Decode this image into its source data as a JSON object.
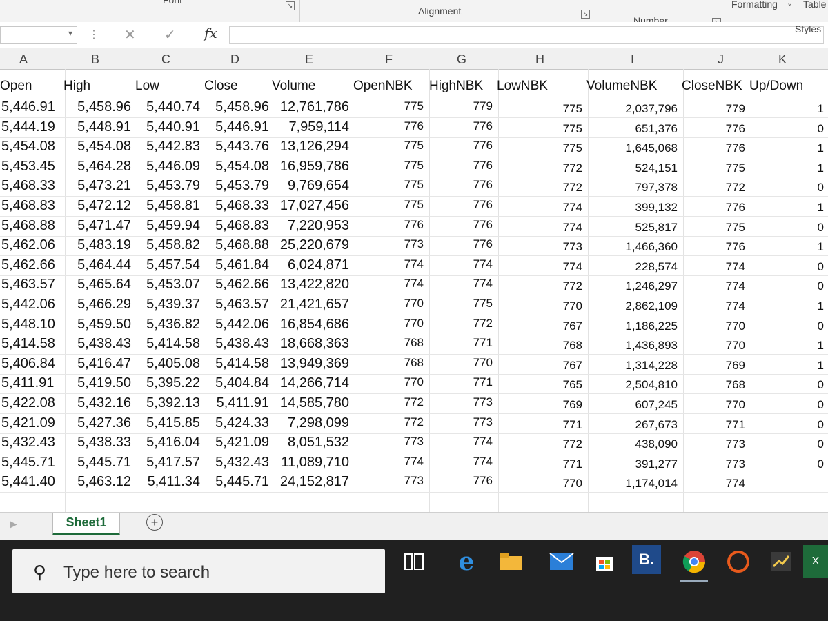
{
  "ribbon": {
    "font_label": "Font",
    "alignment_label": "Alignment",
    "number_label": "Number",
    "formatting_label": "Formatting",
    "table_label": "Table",
    "styles_label": "Styles"
  },
  "formula_bar": {
    "fx_label": "fx",
    "value": ""
  },
  "grid": {
    "column_letters": [
      "A",
      "B",
      "C",
      "D",
      "E",
      "F",
      "G",
      "H",
      "I",
      "J",
      "K"
    ],
    "headers": [
      "Open",
      "High",
      "Low",
      "Close",
      "Volume",
      "OpenNBK",
      "HighNBK",
      "LowNBK",
      "VolumeNBK",
      "CloseNBK",
      "Up/Down"
    ],
    "rows": [
      [
        "5,446.91",
        "5,458.96",
        "5,440.74",
        "5,458.96",
        "12,761,786",
        "775",
        "779",
        "775",
        "2,037,796",
        "779",
        "1"
      ],
      [
        "5,444.19",
        "5,448.91",
        "5,440.91",
        "5,446.91",
        "7,959,114",
        "776",
        "776",
        "775",
        "651,376",
        "776",
        "0"
      ],
      [
        "5,454.08",
        "5,454.08",
        "5,442.83",
        "5,443.76",
        "13,126,294",
        "775",
        "776",
        "775",
        "1,645,068",
        "776",
        "1"
      ],
      [
        "5,453.45",
        "5,464.28",
        "5,446.09",
        "5,454.08",
        "16,959,786",
        "775",
        "776",
        "772",
        "524,151",
        "775",
        "1"
      ],
      [
        "5,468.33",
        "5,473.21",
        "5,453.79",
        "5,453.79",
        "9,769,654",
        "775",
        "776",
        "772",
        "797,378",
        "772",
        "0"
      ],
      [
        "5,468.83",
        "5,472.12",
        "5,458.81",
        "5,468.33",
        "17,027,456",
        "775",
        "776",
        "774",
        "399,132",
        "776",
        "1"
      ],
      [
        "5,468.88",
        "5,471.47",
        "5,459.94",
        "5,468.83",
        "7,220,953",
        "776",
        "776",
        "774",
        "525,817",
        "775",
        "0"
      ],
      [
        "5,462.06",
        "5,483.19",
        "5,458.82",
        "5,468.88",
        "25,220,679",
        "773",
        "776",
        "773",
        "1,466,360",
        "776",
        "1"
      ],
      [
        "5,462.66",
        "5,464.44",
        "5,457.54",
        "5,461.84",
        "6,024,871",
        "774",
        "774",
        "774",
        "228,574",
        "774",
        "0"
      ],
      [
        "5,463.57",
        "5,465.64",
        "5,453.07",
        "5,462.66",
        "13,422,820",
        "774",
        "774",
        "772",
        "1,246,297",
        "774",
        "0"
      ],
      [
        "5,442.06",
        "5,466.29",
        "5,439.37",
        "5,463.57",
        "21,421,657",
        "770",
        "775",
        "770",
        "2,862,109",
        "774",
        "1"
      ],
      [
        "5,448.10",
        "5,459.50",
        "5,436.82",
        "5,442.06",
        "16,854,686",
        "770",
        "772",
        "767",
        "1,186,225",
        "770",
        "0"
      ],
      [
        "5,414.58",
        "5,438.43",
        "5,414.58",
        "5,438.43",
        "18,668,363",
        "768",
        "771",
        "768",
        "1,436,893",
        "770",
        "1"
      ],
      [
        "5,406.84",
        "5,416.47",
        "5,405.08",
        "5,414.58",
        "13,949,369",
        "768",
        "770",
        "767",
        "1,314,228",
        "769",
        "1"
      ],
      [
        "5,411.91",
        "5,419.50",
        "5,395.22",
        "5,404.84",
        "14,266,714",
        "770",
        "771",
        "765",
        "2,504,810",
        "768",
        "0"
      ],
      [
        "5,422.08",
        "5,432.16",
        "5,392.13",
        "5,411.91",
        "14,585,780",
        "772",
        "773",
        "769",
        "607,245",
        "770",
        "0"
      ],
      [
        "5,421.09",
        "5,427.36",
        "5,415.85",
        "5,424.33",
        "7,298,099",
        "772",
        "773",
        "771",
        "267,673",
        "771",
        "0"
      ],
      [
        "5,432.43",
        "5,438.33",
        "5,416.04",
        "5,421.09",
        "8,051,532",
        "773",
        "774",
        "772",
        "438,090",
        "773",
        "0"
      ],
      [
        "5,445.71",
        "5,445.71",
        "5,417.57",
        "5,432.43",
        "11,089,710",
        "774",
        "774",
        "771",
        "391,277",
        "773",
        "0"
      ],
      [
        "5,441.40",
        "5,463.12",
        "5,411.34",
        "5,445.71",
        "24,152,817",
        "773",
        "776",
        "770",
        "1,174,014",
        "774",
        ""
      ]
    ]
  },
  "sheet_tabs": {
    "active": "Sheet1",
    "add_label": "+"
  },
  "taskbar": {
    "search_placeholder": "Type here to search",
    "booking_label": "B.",
    "excel_label": "X"
  }
}
